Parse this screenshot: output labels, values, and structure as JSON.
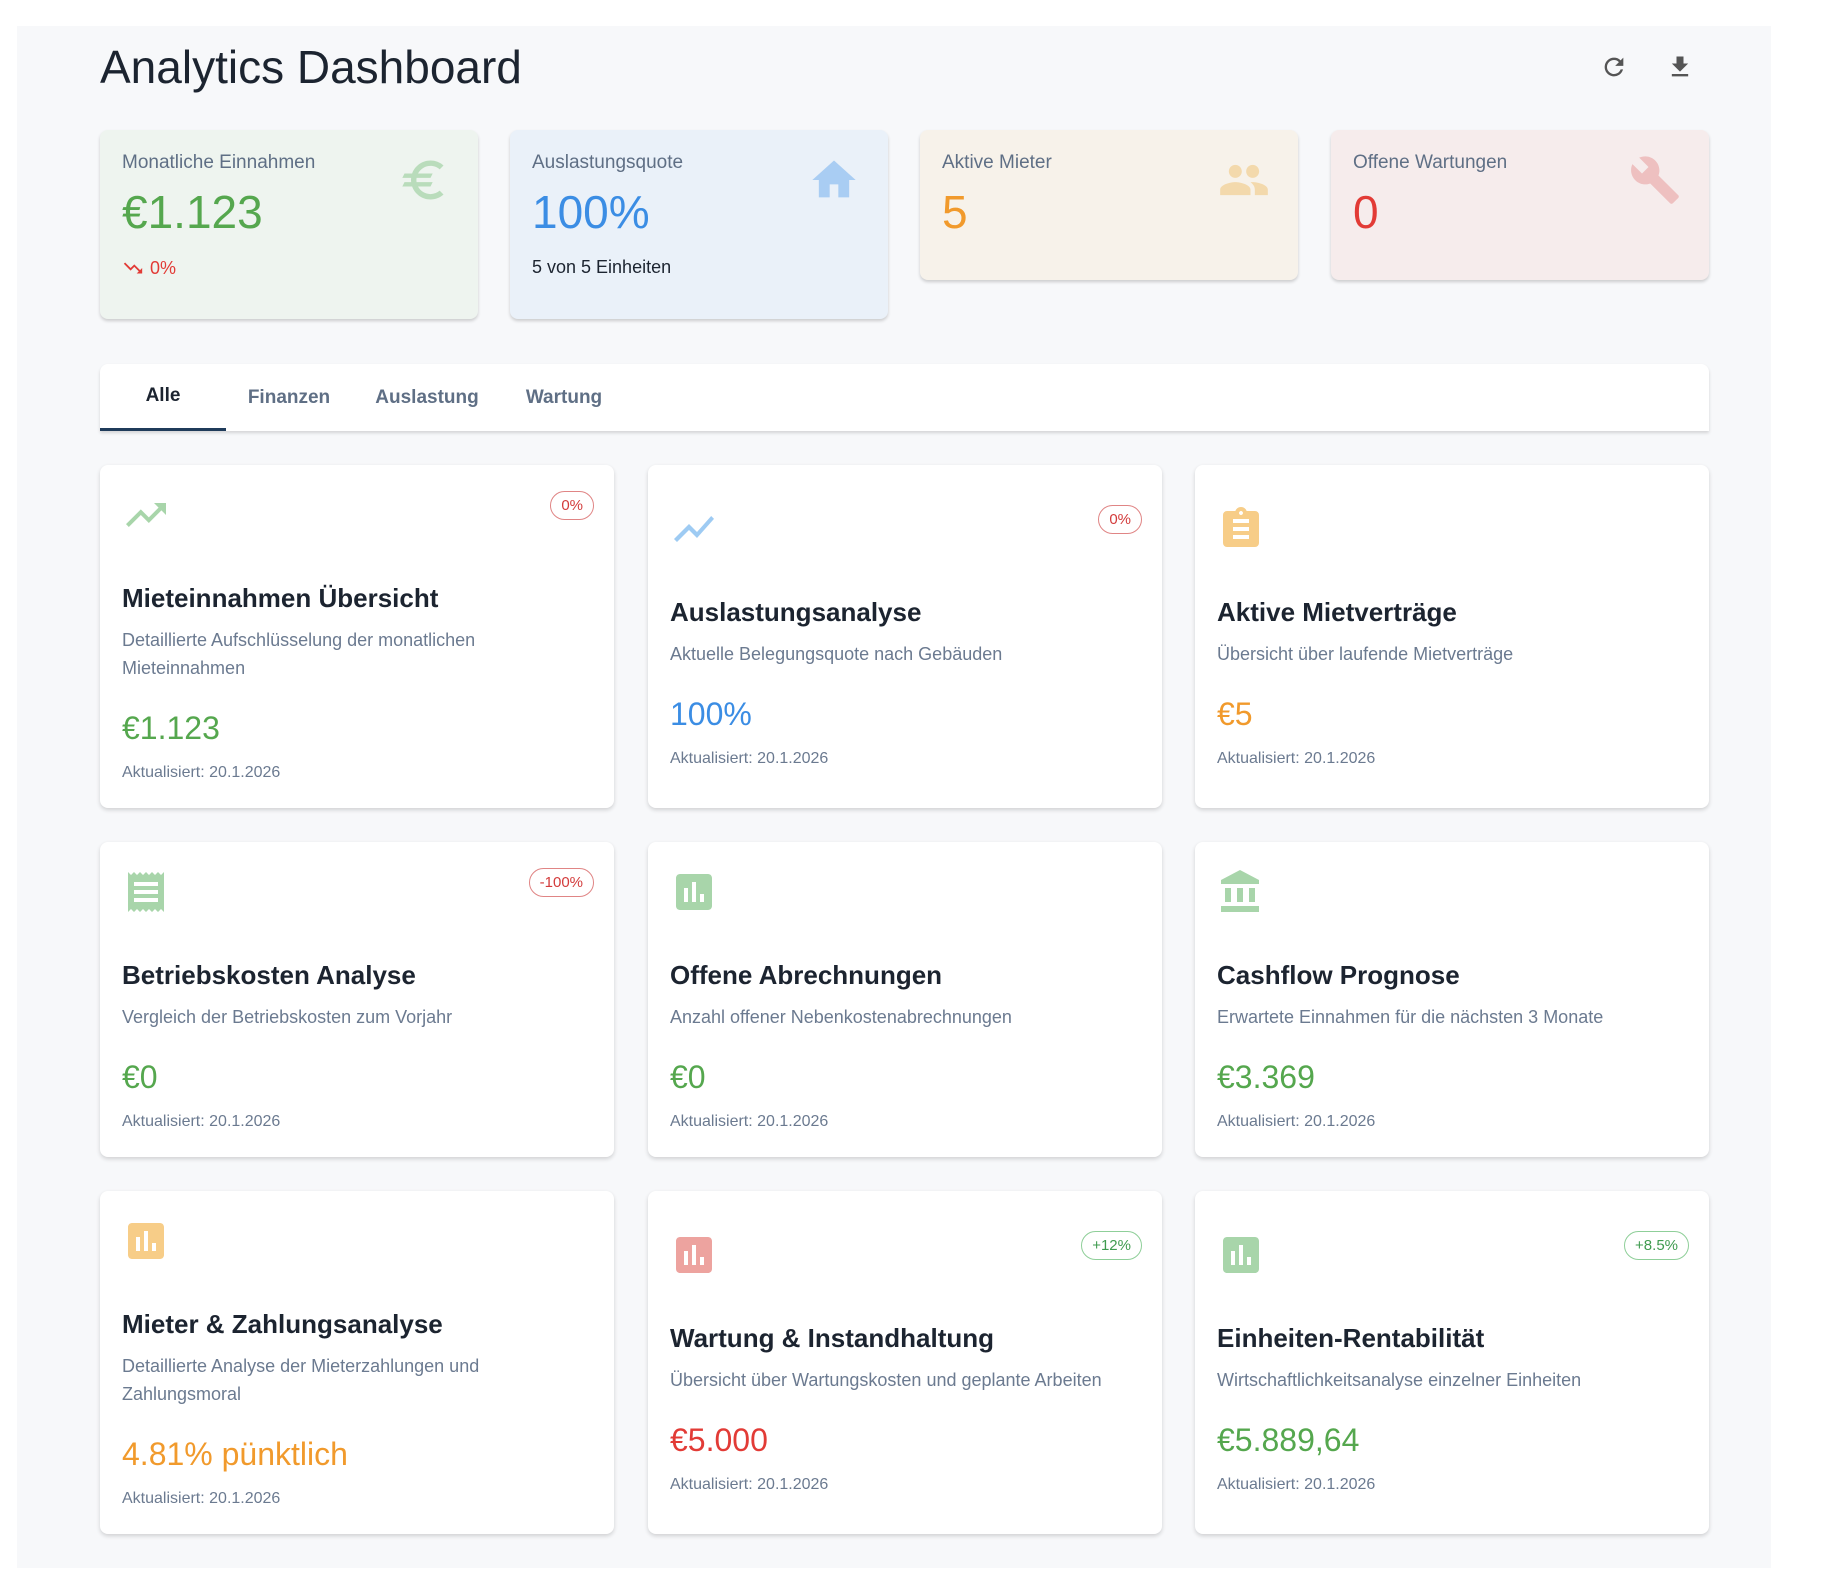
{
  "header": {
    "title": "Analytics Dashboard",
    "refresh_icon": "refresh-icon",
    "download_icon": "download-icon"
  },
  "colors": {
    "green": "#55a74e",
    "blue": "#3b8de4",
    "orange": "#f19a2c",
    "red": "#e23b36"
  },
  "stats": [
    {
      "label": "Monatliche Einnahmen",
      "value": "€1.123",
      "trend": "0%",
      "trend_icon": "trending-down-icon",
      "icon": "euro-icon"
    },
    {
      "label": "Auslastungsquote",
      "value": "100%",
      "sub": "5 von 5 Einheiten",
      "icon": "home-icon"
    },
    {
      "label": "Aktive Mieter",
      "value": "5",
      "icon": "people-icon"
    },
    {
      "label": "Offene Wartungen",
      "value": "0",
      "icon": "wrench-icon"
    }
  ],
  "tabs": [
    {
      "label": "Alle",
      "active": true
    },
    {
      "label": "Finanzen"
    },
    {
      "label": "Auslastung"
    },
    {
      "label": "Wartung"
    }
  ],
  "cards": [
    {
      "title": "Mieteinnahmen Übersicht",
      "description": "Detaillierte Aufschlüsselung der monatlichen Mieteinnahmen",
      "value": "€1.123",
      "updated": "Aktualisiert: 20.1.2026",
      "badge": "0%",
      "icon": "trending-up-icon"
    },
    {
      "title": "Auslastungsanalyse",
      "description": "Aktuelle Belegungsquote nach Gebäuden",
      "value": "100%",
      "updated": "Aktualisiert: 20.1.2026",
      "badge": "0%",
      "icon": "show-chart-icon"
    },
    {
      "title": "Aktive Mietverträge",
      "description": "Übersicht über laufende Mietverträge",
      "value": "€5",
      "updated": "Aktualisiert: 20.1.2026",
      "icon": "clipboard-icon"
    },
    {
      "title": "Betriebskosten Analyse",
      "description": "Vergleich der Betriebskosten zum Vorjahr",
      "value": "€0",
      "updated": "Aktualisiert: 20.1.2026",
      "badge": "-100%",
      "icon": "receipt-icon"
    },
    {
      "title": "Offene Abrechnungen",
      "description": "Anzahl offener Nebenkostenabrechnungen",
      "value": "€0",
      "updated": "Aktualisiert: 20.1.2026",
      "icon": "bar-chart-icon"
    },
    {
      "title": "Cashflow Prognose",
      "description": "Erwartete Einnahmen für die nächsten 3 Monate",
      "value": "€3.369",
      "updated": "Aktualisiert: 20.1.2026",
      "icon": "bank-icon"
    },
    {
      "title": "Mieter & Zahlungsanalyse",
      "description": "Detaillierte Analyse der Mieterzahlungen und Zahlungsmoral",
      "value": "4.81% pünktlich",
      "updated": "Aktualisiert: 20.1.2026",
      "icon": "bar-chart-icon"
    },
    {
      "title": "Wartung & Instandhaltung",
      "description": "Übersicht über Wartungskosten und geplante Arbeiten",
      "value": "€5.000",
      "updated": "Aktualisiert: 20.1.2026",
      "badge": "+12%",
      "icon": "bar-chart-icon"
    },
    {
      "title": "Einheiten-Rentabilität",
      "description": "Wirtschaftlichkeitsanalyse einzelner Einheiten",
      "value": "€5.889,64",
      "updated": "Aktualisiert: 20.1.2026",
      "badge": "+8.5%",
      "icon": "bar-chart-icon"
    }
  ]
}
